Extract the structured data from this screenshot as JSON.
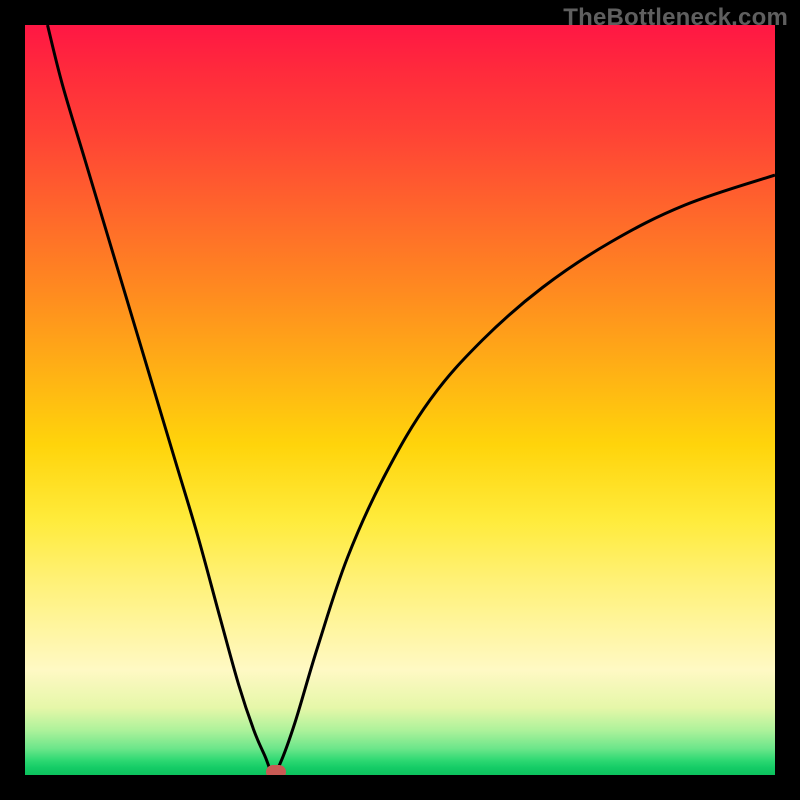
{
  "watermark": "TheBottleneck.com",
  "colors": {
    "frame": "#000000",
    "curve": "#000000",
    "marker": "#c85a54"
  },
  "chart_data": {
    "type": "line",
    "title": "",
    "xlabel": "",
    "ylabel": "",
    "xlim": [
      0,
      100
    ],
    "ylim": [
      0,
      100
    ],
    "grid": false,
    "background_gradient": {
      "direction": "vertical",
      "stops": [
        {
          "pos": 0,
          "color": "#ff1744"
        },
        {
          "pos": 14,
          "color": "#ff4136"
        },
        {
          "pos": 36,
          "color": "#ff8c1f"
        },
        {
          "pos": 56,
          "color": "#ffd40b"
        },
        {
          "pos": 74,
          "color": "#fff176"
        },
        {
          "pos": 86,
          "color": "#fff9c4"
        },
        {
          "pos": 94,
          "color": "#aef29b"
        },
        {
          "pos": 98,
          "color": "#2fd973"
        },
        {
          "pos": 100,
          "color": "#0cc15d"
        }
      ]
    },
    "series": [
      {
        "name": "bottleneck-curve",
        "x": [
          3,
          5,
          8,
          11,
          14,
          17,
          20,
          23,
          26,
          28.5,
          30.5,
          32,
          33,
          34,
          36,
          39,
          43,
          48,
          54,
          61,
          69,
          78,
          88,
          100
        ],
        "y": [
          100,
          92,
          82,
          72,
          62,
          52,
          42,
          32,
          21,
          12,
          6,
          2.5,
          0.3,
          1.5,
          7,
          17,
          29,
          40,
          50,
          58,
          65,
          71,
          76,
          80
        ]
      }
    ],
    "marker": {
      "x": 33.5,
      "y": 0.4,
      "color": "#c85a54"
    }
  }
}
